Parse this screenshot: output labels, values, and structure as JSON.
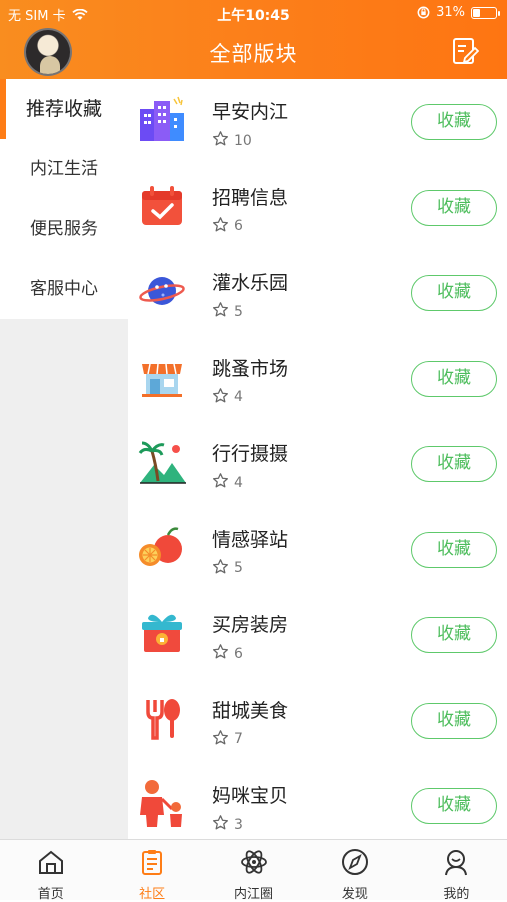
{
  "status": {
    "carrier": "无 SIM 卡",
    "time": "上午10:45",
    "battery": "31%",
    "battery_level": 0.31
  },
  "header": {
    "title": "全部版块"
  },
  "sidebar": {
    "items": [
      {
        "label": "推荐收藏",
        "active": true
      },
      {
        "label": "内江生活"
      },
      {
        "label": "便民服务"
      },
      {
        "label": "客服中心"
      }
    ]
  },
  "boards": [
    {
      "title": "早安内江",
      "count": "10",
      "icon": "buildings-icon"
    },
    {
      "title": "招聘信息",
      "count": "6",
      "icon": "calendar-check-icon"
    },
    {
      "title": "灌水乐园",
      "count": "5",
      "icon": "planet-icon"
    },
    {
      "title": "跳蚤市场",
      "count": "4",
      "icon": "shop-icon"
    },
    {
      "title": "行行摄摄",
      "count": "4",
      "icon": "palm-landscape-icon"
    },
    {
      "title": "情感驿站",
      "count": "5",
      "icon": "fruit-icon"
    },
    {
      "title": "买房装房",
      "count": "6",
      "icon": "gift-box-icon"
    },
    {
      "title": "甜城美食",
      "count": "7",
      "icon": "fork-spoon-icon"
    },
    {
      "title": "妈咪宝贝",
      "count": "3",
      "icon": "parent-child-icon"
    }
  ],
  "favorite_label": "收藏",
  "tabbar": {
    "items": [
      {
        "label": "首页",
        "icon": "home-icon"
      },
      {
        "label": "社区",
        "icon": "community-icon",
        "active": true
      },
      {
        "label": "内江圈",
        "icon": "atom-icon"
      },
      {
        "label": "发现",
        "icon": "compass-icon"
      },
      {
        "label": "我的",
        "icon": "profile-icon"
      }
    ]
  },
  "colors": {
    "header": "#fe7d16",
    "accent": "#fe7d16",
    "favorite": "#5ec96b",
    "sidebar_bg": "#efefef"
  }
}
